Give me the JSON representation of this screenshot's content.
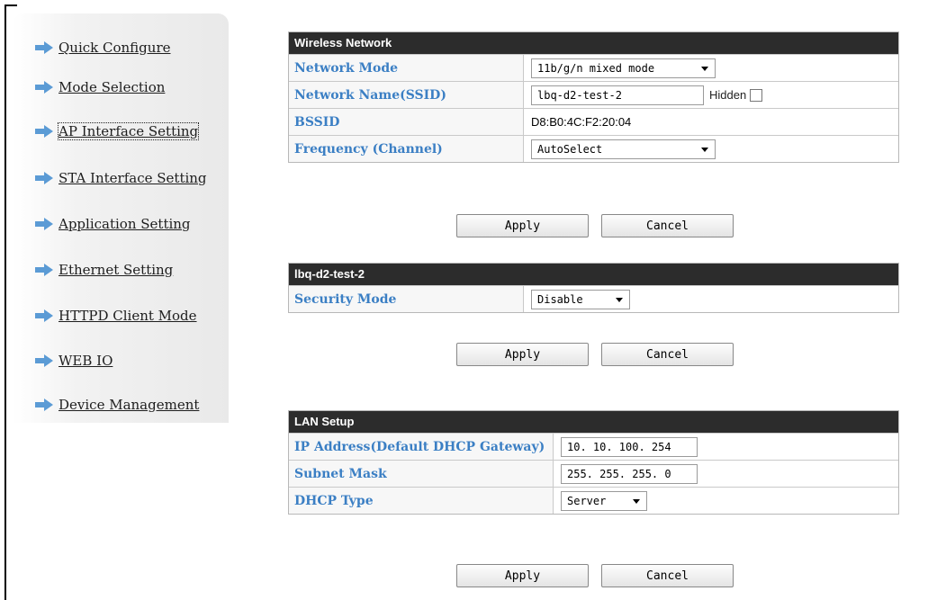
{
  "sidebar": {
    "items": [
      {
        "label": "Quick Configure"
      },
      {
        "label": "Mode Selection"
      },
      {
        "label": "AP Interface Setting"
      },
      {
        "label": "STA Interface Setting"
      },
      {
        "label": "Application Setting"
      },
      {
        "label": "Ethernet Setting"
      },
      {
        "label": "HTTPD Client Mode"
      },
      {
        "label": "WEB IO"
      },
      {
        "label": "Device Management"
      }
    ],
    "active_index": 2,
    "arrow_color": "#5b9bd5"
  },
  "wireless": {
    "title": "Wireless Network",
    "network_mode_label": "Network Mode",
    "network_mode_value": "11b/g/n mixed mode",
    "ssid_label": "Network Name(SSID)",
    "ssid_value": "lbq-d2-test-2",
    "hidden_label": "Hidden",
    "hidden_checked": false,
    "bssid_label": "BSSID",
    "bssid_value": "D8:B0:4C:F2:20:04",
    "frequency_label": "Frequency (Channel)",
    "frequency_value": "AutoSelect",
    "apply_label": "Apply",
    "cancel_label": "Cancel"
  },
  "security": {
    "title": "lbq-d2-test-2",
    "mode_label": "Security Mode",
    "mode_value": "Disable",
    "apply_label": "Apply",
    "cancel_label": "Cancel"
  },
  "lan": {
    "title": "LAN Setup",
    "ip_label": "IP Address(Default DHCP Gateway)",
    "ip_value": "10. 10. 100. 254",
    "subnet_label": "Subnet Mask",
    "subnet_value": "255. 255. 255. 0",
    "dhcp_label": "DHCP Type",
    "dhcp_value": "Server",
    "apply_label": "Apply",
    "cancel_label": "Cancel"
  },
  "colors": {
    "header_bg": "#2c2c2c",
    "label_color": "#3b7fc4"
  }
}
